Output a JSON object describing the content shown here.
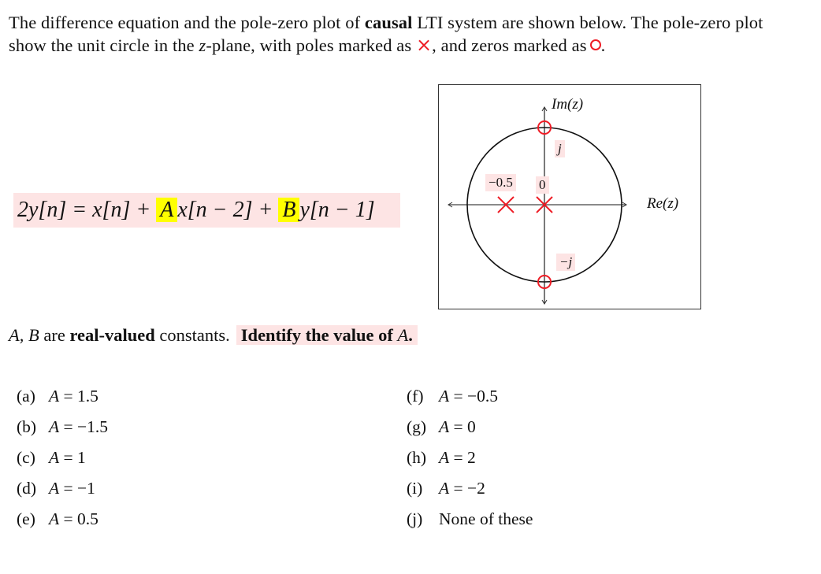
{
  "intro": {
    "part1": "The difference equation and the pole-zero plot of ",
    "bold1": "causal",
    "part2": " LTI system are shown below.  The pole-zero plot show the unit circle in the ",
    "z": "z",
    "part3": "-plane, with poles marked as ",
    "pole_symbol": "×",
    "part4": ", and zeros marked as",
    "part5": "."
  },
  "equation": {
    "lhs": "2y[n] = x[n] + ",
    "A": "A",
    "mid": "x[n − 2] + ",
    "B": "B",
    "rhs": "y[n − 1]"
  },
  "pole_zero_plot": {
    "x_axis_label": "Re(z)",
    "y_axis_label": "Im(z)",
    "unit_circle_radius": 1,
    "poles": [
      {
        "re": -0.5,
        "im": 0,
        "label": "−0.5"
      },
      {
        "re": 0,
        "im": 0,
        "label": "0"
      }
    ],
    "zeros": [
      {
        "re": 0,
        "im": 1,
        "label": "j"
      },
      {
        "re": 0,
        "im": -1,
        "label": "−j"
      }
    ],
    "colors": {
      "marker": "#ee1c25",
      "label_bg": "#fde4e4"
    }
  },
  "statement": {
    "vars": "A, B",
    "are": " are ",
    "bold": "real-valued",
    "rest": " constants.",
    "ask": "Identify the value of ",
    "ask_var": "A",
    "ask_end": "."
  },
  "options": [
    {
      "letter": "(a)",
      "text": "A = 1.5"
    },
    {
      "letter": "(b)",
      "text": "A = −1.5"
    },
    {
      "letter": "(c)",
      "text": "A = 1"
    },
    {
      "letter": "(d)",
      "text": "A = −1"
    },
    {
      "letter": "(e)",
      "text": "A = 0.5"
    },
    {
      "letter": "(f)",
      "text": "A = −0.5"
    },
    {
      "letter": "(g)",
      "text": "A = 0"
    },
    {
      "letter": "(h)",
      "text": "A = 2"
    },
    {
      "letter": "(i)",
      "text": "A = −2"
    },
    {
      "letter": "(j)",
      "text": "None of these"
    }
  ]
}
